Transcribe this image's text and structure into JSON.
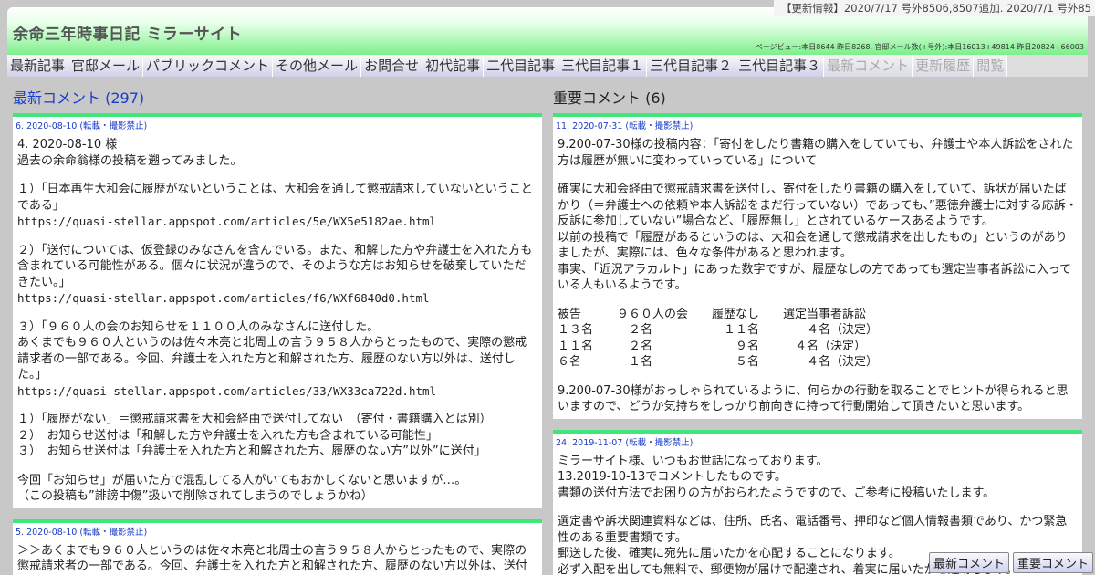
{
  "header": {
    "site_title": "余命三年時事日記 ミラーサイト",
    "update_info": "【更新情報】2020/7/17 号外8506,8507追加. 2020/7/1 号外85",
    "pageview": "ページビュー:本日8644 昨日8268, 官邸メール数(+号外):本日16013+49814 昨日20824+66003"
  },
  "nav": [
    {
      "label": "最新記事"
    },
    {
      "label": "官邸メール"
    },
    {
      "label": "パブリックコメント"
    },
    {
      "label": "その他メール"
    },
    {
      "label": "お問合せ"
    },
    {
      "label": "初代記事"
    },
    {
      "label": "二代目記事"
    },
    {
      "label": "三代目記事１"
    },
    {
      "label": "三代目記事２"
    },
    {
      "label": "三代目記事３"
    },
    {
      "label": "最新コメント"
    },
    {
      "label": "更新履歴"
    },
    {
      "label": "閲覧"
    }
  ],
  "left": {
    "title": "最新コメント (297)",
    "cards": [
      {
        "head": "6. 2020-08-10",
        "note": "(転載・撮影禁止)",
        "lines": [
          "4. 2020-08-10 様",
          "過去の余命翁様の投稿を遡ってみました。",
          "",
          "１）「日本再生大和会に履歴がないということは、大和会を通して懲戒請求していないということである」",
          "https://quasi-stellar.appspot.com/articles/5e/WX5e5182ae.html",
          "",
          "２）「送付については、仮登録のみなさんを含んでいる。また、和解した方や弁護士を入れた方も含まれている可能性がある。個々に状況が違うので、そのような方はお知らせを破棄していただきたい。」",
          "https://quasi-stellar.appspot.com/articles/f6/WXf6840d0.html",
          "",
          "３）「９６０人の会のお知らせを１１００人のみなさんに送付した。",
          "あくまでも９６０人というのは佐々木亮と北周士の言う９５８人からとったもので、実際の懲戒請求者の一部である。今回、弁護士を入れた方と和解された方、履歴のない方以外は、送付した。」",
          "https://quasi-stellar.appspot.com/articles/33/WX33ca722d.html",
          "",
          "１）「履歴がない」＝懲戒請求書を大和会経由で送付してない　（寄付・書籍購入とは別）",
          "２）　お知らせ送付は「和解した方や弁護士を入れた方も含まれている可能性」",
          "３）　お知らせ送付は「弁護士を入れた方と和解された方、履歴のない方”以外”に送付」",
          "",
          "今回「お知らせ」が届いた方で混乱してる人がいてもおかしくないと思いますが…。",
          "（この投稿も”誹謗中傷”扱いで削除されてしまうのでしょうかね）"
        ]
      },
      {
        "head": "5. 2020-08-10",
        "note": "(転載・撮影禁止)",
        "lines": [
          "＞＞あくまでも９６０人というのは佐々木亮と北周士の言う９５８人からとったもので、実際の懲戒請求者の一部である。今回、弁護士を入れた方と和解された方、履歴のない方以外は、送付"
        ]
      }
    ]
  },
  "right": {
    "title": "重要コメント (6)",
    "cards": [
      {
        "head": "11. 2020-07-31",
        "note": "(転載・撮影禁止)",
        "lines": [
          "9.200-07-30様の投稿内容：「寄付をしたり書籍の購入をしていても、弁護士や本人訴訟をされた方は履歴が無いに変わっていっている」について",
          "",
          "確実に大和会経由で懲戒請求書を送付し、寄付をしたり書籍の購入をしていて、訴状が届いたばかり（＝弁護士への依頼や本人訴訟をまだ行っていない）であっても、”悪徳弁護士に対する応訴・反訴に参加していない”場合など、「履歴無し」とされているケースあるようです。",
          "以前の投稿で「履歴があるというのは、大和会を通して懲戒請求を出したもの」というのがありましたが、実際には、色々な条件があると思われます。",
          "事実、「近況アラカルト」にあった数字ですが、履歴なしの方であっても選定当事者訴訟に入っている人もいるようです。",
          "",
          "被告　　　９６０人の会　　履歴なし　　選定当事者訴訟",
          "１３名　　　２名　　　　　　１１名　　　　４名（決定）",
          "１１名　　　２名　　　　　　　９名　　　４名（決定）",
          "６名　　　　１名　　　　　　　５名　　　　４名（決定）",
          "",
          "9.200-07-30様がおっしゃられているように、何らかの行動を取ることでヒントが得られると思いますので、どうか気持ちをしっかり前向きに持って行動開始して頂きたいと思います。"
        ]
      },
      {
        "head": "24. 2019-11-07",
        "note": "(転載・撮影禁止)",
        "lines": [
          "ミラーサイト様、いつもお世話になっております。",
          "13.2019-10-13でコメントしたものです。",
          "書類の送付方法でお困りの方がおられたようですので、ご参考に投稿いたします。",
          "",
          "選定書や訴状関連資料などは、住所、氏名、電話番号、押印など個人情報書類であり、かつ緊急性のある重要書類です。",
          "郵送した後、確実に宛先に届いたかを心配することになります。",
          "必ず入配を出しても無料で、郵便物が届けで配達され、着実に届いたかを追跡します。"
        ]
      }
    ]
  },
  "float_buttons": {
    "latest": "最新コメント",
    "important": "重要コメント"
  }
}
